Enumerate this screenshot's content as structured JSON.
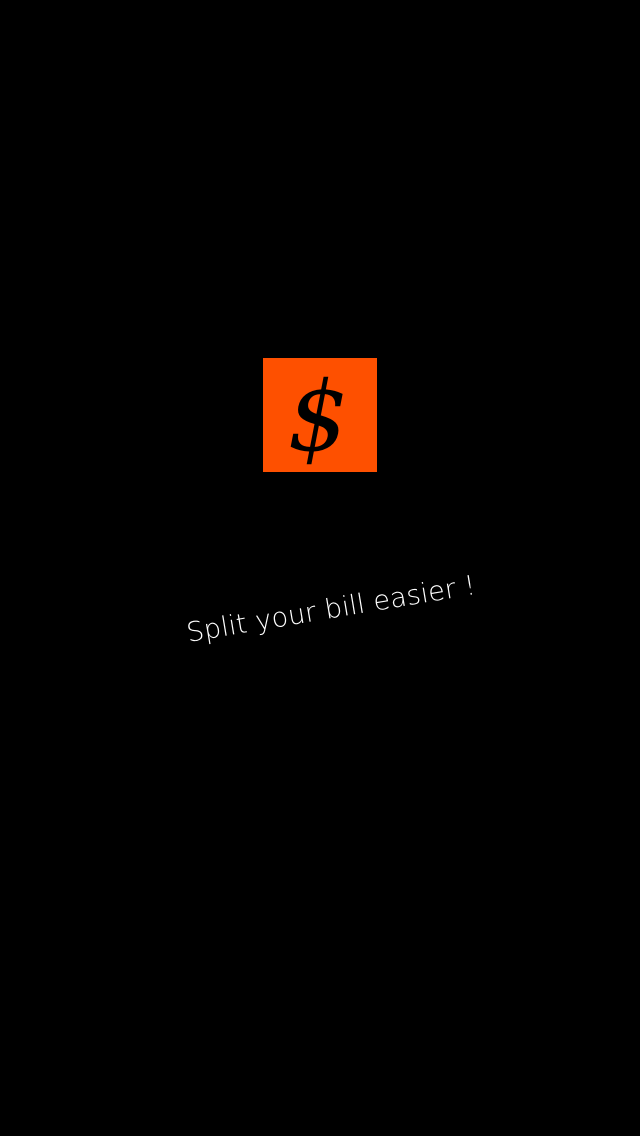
{
  "splash": {
    "logo": {
      "glyph": "$",
      "icon": "dollar-icon",
      "tile_color": "#fe5000",
      "glyph_color": "#000000"
    },
    "tagline": "Split your bill easier !",
    "background_color": "#000000",
    "tagline_color": "#ffffff"
  }
}
